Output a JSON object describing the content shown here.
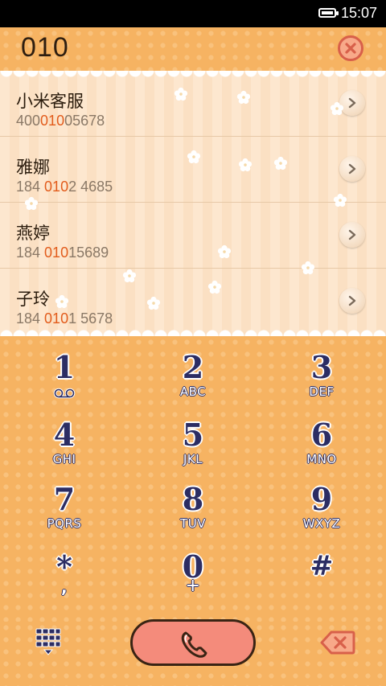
{
  "status_bar": {
    "time": "15:07",
    "battery_icon": "battery-icon"
  },
  "dialer": {
    "number": "010",
    "clear_icon": "clear-x-icon"
  },
  "contacts": [
    {
      "name": "小米客服",
      "num_pre": "400",
      "num_hl": "010",
      "num_post": "05678"
    },
    {
      "name": "雅娜",
      "num_pre": "184 ",
      "num_hl": "010",
      "num_post": "2 4685"
    },
    {
      "name": "燕婷",
      "num_pre": "184 ",
      "num_hl": "010",
      "num_post": "15689"
    },
    {
      "name": "子玲",
      "num_pre": "184 ",
      "num_hl": "010",
      "num_post": "1 5678"
    }
  ],
  "keys": [
    {
      "digit": "1",
      "letters": ""
    },
    {
      "digit": "2",
      "letters": "ABC"
    },
    {
      "digit": "3",
      "letters": "DEF"
    },
    {
      "digit": "4",
      "letters": "GHI"
    },
    {
      "digit": "5",
      "letters": "JKL"
    },
    {
      "digit": "6",
      "letters": "MNO"
    },
    {
      "digit": "7",
      "letters": "PQRS"
    },
    {
      "digit": "8",
      "letters": "TUV"
    },
    {
      "digit": "9",
      "letters": "WXYZ"
    },
    {
      "digit": "*",
      "letters": ","
    },
    {
      "digit": "0",
      "letters": "+"
    },
    {
      "digit": "#",
      "letters": ""
    }
  ],
  "bottom_bar": {
    "keypad_toggle_icon": "keypad-grid-icon",
    "call_icon": "phone-icon",
    "backspace_icon": "backspace-icon"
  },
  "colors": {
    "background": "#f6b362",
    "highlight": "#e25c1c",
    "key_digit": "#2c2d63",
    "call_button": "#f48b7b"
  }
}
